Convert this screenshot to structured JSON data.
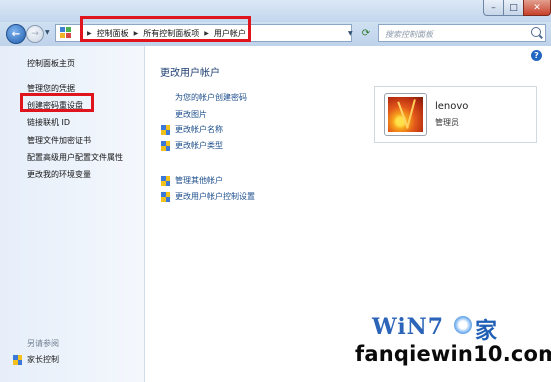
{
  "address_bar": {
    "breadcrumbs": [
      "控制面板",
      "所有控制面板项",
      "用户帐户"
    ],
    "search_placeholder": "搜索控制面板"
  },
  "sidebar": {
    "links": [
      "控制面板主页",
      "管理您的凭据",
      "创建密码重设盘",
      "链接联机 ID",
      "管理文件加密证书",
      "配置高级用户配置文件属性",
      "更改我的环境变量"
    ],
    "see_also_label": "另请参阅",
    "parental_controls": "家长控制"
  },
  "main": {
    "title": "更改用户帐户",
    "tasks_plain": [
      "为您的帐户创建密码",
      "更改图片"
    ],
    "tasks_shield": [
      "更改帐户名称",
      "更改帐户类型"
    ],
    "tasks_other": [
      "管理其他帐户",
      "更改用户帐户控制设置"
    ]
  },
  "account": {
    "name": "lenovo",
    "role": "管理员"
  },
  "watermark": {
    "logo_text": "WiN7",
    "logo_suffix": "家",
    "url": "fanqiewin10.com"
  },
  "colors": {
    "highlight": "#e0141c",
    "link": "#1c4e8d",
    "title": "#1f3f73"
  }
}
